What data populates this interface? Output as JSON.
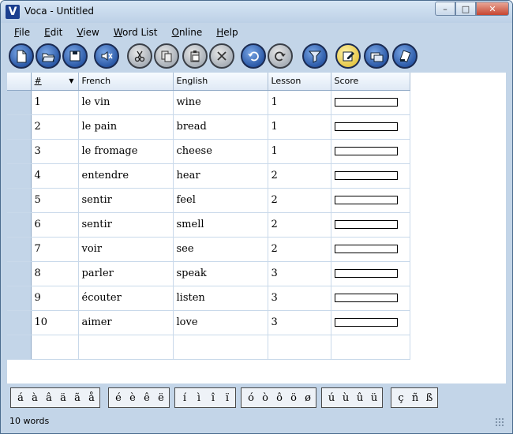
{
  "window": {
    "title": "Voca - Untitled",
    "min": "–",
    "max": "□",
    "close": "✕"
  },
  "menu": [
    {
      "label": "File",
      "mnemonic": "F",
      "rest": "ile"
    },
    {
      "label": "Edit",
      "mnemonic": "E",
      "rest": "dit"
    },
    {
      "label": "View",
      "mnemonic": "V",
      "rest": "iew"
    },
    {
      "label": "Word List",
      "mnemonic": "W",
      "rest": "ord List"
    },
    {
      "label": "Online",
      "mnemonic": "O",
      "rest": "nline"
    },
    {
      "label": "Help",
      "mnemonic": "H",
      "rest": "elp"
    }
  ],
  "toolbar": [
    {
      "name": "new-file-button",
      "icon": "new-file-icon",
      "style": "blue"
    },
    {
      "name": "open-button",
      "icon": "open-folder-icon",
      "style": "blue"
    },
    {
      "name": "save-button",
      "icon": "save-disk-icon",
      "style": "blue"
    },
    {
      "name": "sound-button",
      "icon": "speaker-icon",
      "style": "blue"
    },
    {
      "name": "cut-button",
      "icon": "scissors-icon",
      "style": "gray"
    },
    {
      "name": "copy-button",
      "icon": "copy-icon",
      "style": "gray"
    },
    {
      "name": "paste-button",
      "icon": "clipboard-icon",
      "style": "gray"
    },
    {
      "name": "delete-button",
      "icon": "x-icon",
      "style": "gray"
    },
    {
      "name": "undo-button",
      "icon": "undo-icon",
      "style": "blue"
    },
    {
      "name": "redo-button",
      "icon": "redo-icon",
      "style": "gray"
    },
    {
      "name": "filter-button",
      "icon": "funnel-icon",
      "style": "blue"
    },
    {
      "name": "edit-mode-button",
      "icon": "edit-pencil-icon",
      "style": "active"
    },
    {
      "name": "practice-button",
      "icon": "cards-icon",
      "style": "blue"
    },
    {
      "name": "test-button",
      "icon": "test-paper-icon",
      "style": "blue"
    }
  ],
  "grid": {
    "columns": [
      "#",
      "French",
      "English",
      "Lesson",
      "Score"
    ],
    "sort_indicator": "▼",
    "rows": [
      {
        "num": "1",
        "french": "le vin",
        "english": "wine",
        "lesson": "1"
      },
      {
        "num": "2",
        "french": "le pain",
        "english": "bread",
        "lesson": "1"
      },
      {
        "num": "3",
        "french": "le fromage",
        "english": "cheese",
        "lesson": "1"
      },
      {
        "num": "4",
        "french": "entendre",
        "english": "hear",
        "lesson": "2"
      },
      {
        "num": "5",
        "french": "sentir",
        "english": "feel",
        "lesson": "2"
      },
      {
        "num": "6",
        "french": "sentir",
        "english": "smell",
        "lesson": "2"
      },
      {
        "num": "7",
        "french": "voir",
        "english": "see",
        "lesson": "2"
      },
      {
        "num": "8",
        "french": "parler",
        "english": "speak",
        "lesson": "3"
      },
      {
        "num": "9",
        "french": "écouter",
        "english": "listen",
        "lesson": "3"
      },
      {
        "num": "10",
        "french": "aimer",
        "english": "love",
        "lesson": "3"
      }
    ]
  },
  "accents": [
    [
      "á",
      "à",
      "â",
      "ä",
      "ã",
      "å"
    ],
    [
      "é",
      "è",
      "ê",
      "ë"
    ],
    [
      "í",
      "ì",
      "î",
      "ï"
    ],
    [
      "ó",
      "ò",
      "ô",
      "ö",
      "ø"
    ],
    [
      "ú",
      "ù",
      "û",
      "ü"
    ],
    [
      "ç",
      "ñ",
      "ß"
    ]
  ],
  "status": {
    "text": "10 words"
  }
}
